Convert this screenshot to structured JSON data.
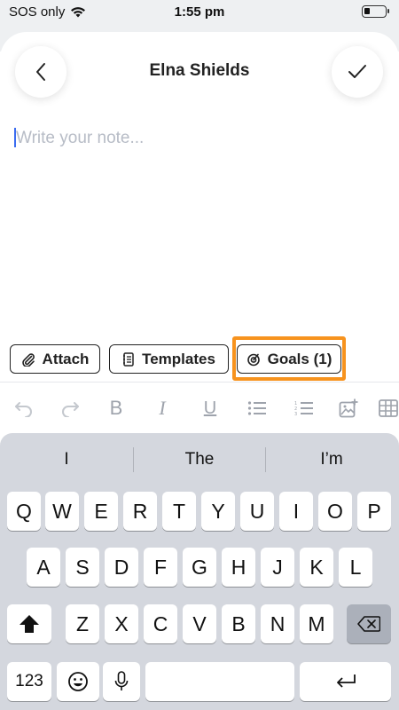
{
  "status_bar": {
    "carrier": "SOS only",
    "time": "1:55 pm"
  },
  "header": {
    "title": "Elna Shields"
  },
  "note": {
    "placeholder": "Write your note..."
  },
  "chips": {
    "attach": "Attach",
    "templates": "Templates",
    "goals": "Goals (1)"
  },
  "toolbar": {
    "bold": "B",
    "italic": "I",
    "underline": "U"
  },
  "keyboard": {
    "suggestions": [
      "I",
      "The",
      "I’m"
    ],
    "row1": [
      "Q",
      "W",
      "E",
      "R",
      "T",
      "Y",
      "U",
      "I",
      "O",
      "P"
    ],
    "row2": [
      "A",
      "S",
      "D",
      "F",
      "G",
      "H",
      "J",
      "K",
      "L"
    ],
    "row3": [
      "Z",
      "X",
      "C",
      "V",
      "B",
      "N",
      "M"
    ],
    "numbers_key": "123"
  },
  "colors": {
    "highlight": "#f7931e",
    "cursor": "#3b6cf0"
  }
}
